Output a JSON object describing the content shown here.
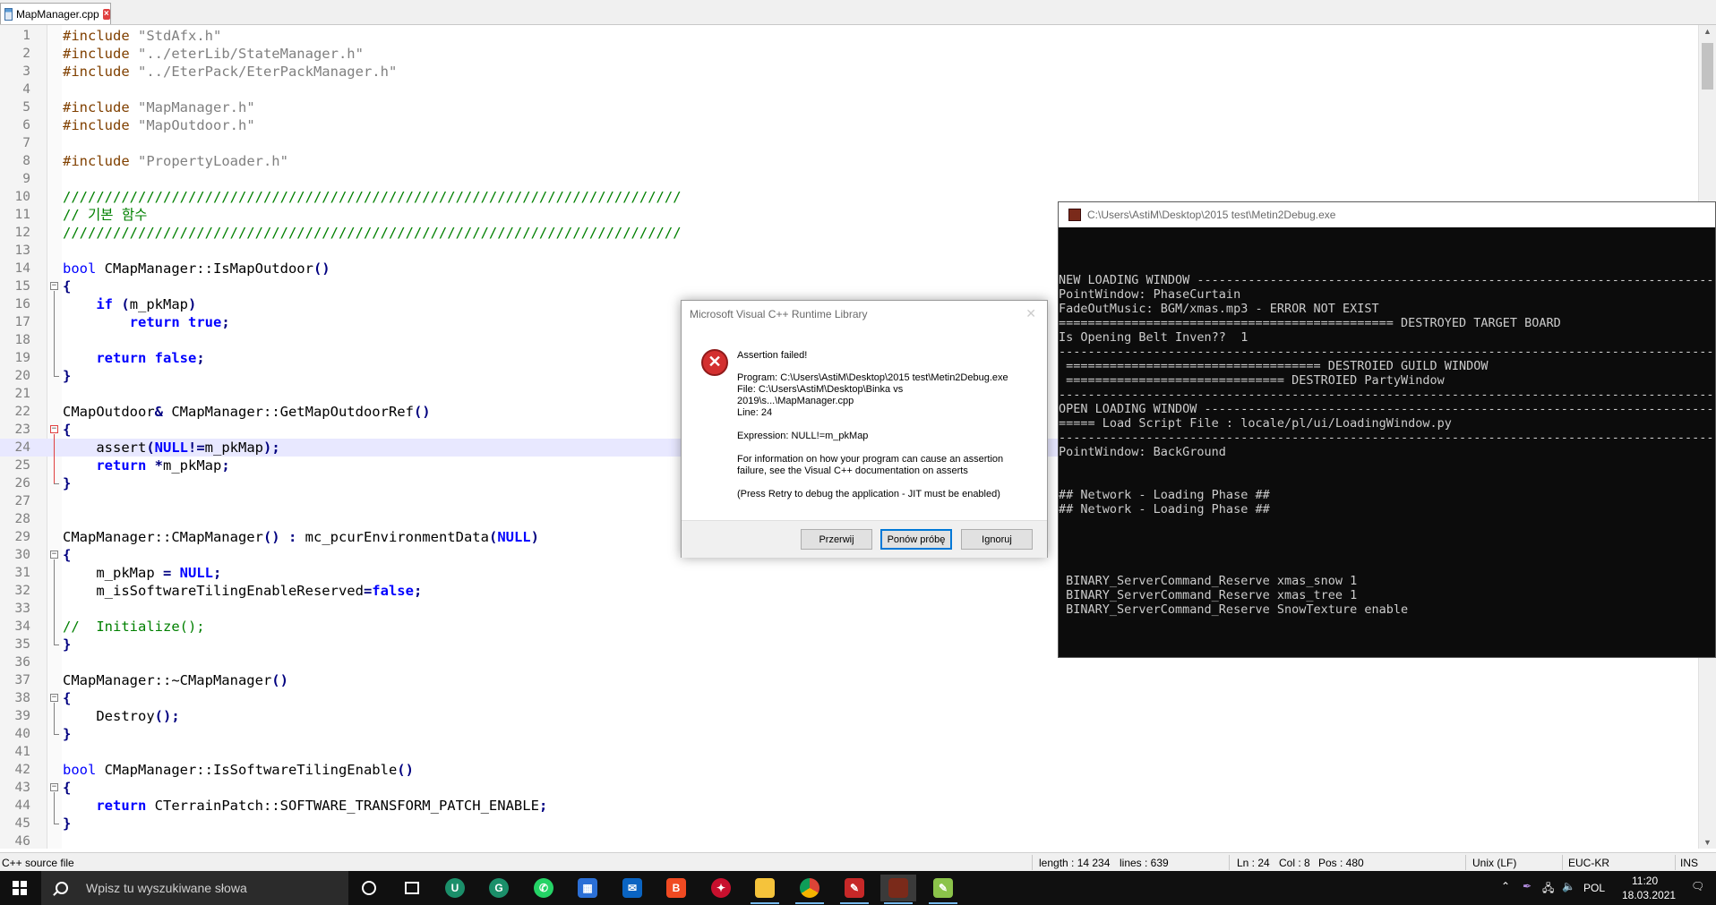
{
  "tab": {
    "filename": "MapManager.cpp"
  },
  "editor": {
    "lines": [
      {
        "n": "1",
        "code": "<span class=\"kw2\" style=\"font-weight:normal;color:#804000\">#include</span> <span class=\"str\">\"StdAfx.h\"</span>"
      },
      {
        "n": "2",
        "code": "<span style=\"color:#804000\">#include</span> <span class=\"str\">\"../eterLib/StateManager.h\"</span>"
      },
      {
        "n": "3",
        "code": "<span style=\"color:#804000\">#include</span> <span class=\"str\">\"../EterPack/EterPackManager.h\"</span>"
      },
      {
        "n": "4",
        "code": ""
      },
      {
        "n": "5",
        "code": "<span style=\"color:#804000\">#include</span> <span class=\"str\">\"MapManager.h\"</span>"
      },
      {
        "n": "6",
        "code": "<span style=\"color:#804000\">#include</span> <span class=\"str\">\"MapOutdoor.h\"</span>"
      },
      {
        "n": "7",
        "code": ""
      },
      {
        "n": "8",
        "code": "<span style=\"color:#804000\">#include</span> <span class=\"str\">\"PropertyLoader.h\"</span>"
      },
      {
        "n": "9",
        "code": ""
      },
      {
        "n": "10",
        "code": "<span class=\"cm\">//////////////////////////////////////////////////////////////////////////</span>"
      },
      {
        "n": "11",
        "code": "<span class=\"cm\">// 기본 함수</span>"
      },
      {
        "n": "12",
        "code": "<span class=\"cm\">//////////////////////////////////////////////////////////////////////////</span>"
      },
      {
        "n": "13",
        "code": ""
      },
      {
        "n": "14",
        "code": "<span class=\"kw\">bool</span> CMapManager::IsMapOutdoor<span class=\"op\">()</span>"
      },
      {
        "n": "15",
        "code": "<span class=\"op\">{</span>"
      },
      {
        "n": "16",
        "code": "    <span class=\"kw\" style=\"font-weight:bold;color:#0000ff\">if</span> <span class=\"op\">(</span>m_pkMap<span class=\"op\">)</span>"
      },
      {
        "n": "17",
        "code": "        <span class=\"kw\" style=\"font-weight:bold\">return</span> <span class=\"kw\" style=\"font-weight:bold\">true</span><span class=\"op\">;</span>"
      },
      {
        "n": "18",
        "code": ""
      },
      {
        "n": "19",
        "code": "    <span class=\"kw\" style=\"font-weight:bold\">return</span> <span class=\"kw\" style=\"font-weight:bold\">false</span><span class=\"op\">;</span>"
      },
      {
        "n": "20",
        "code": "<span class=\"op\">}</span>"
      },
      {
        "n": "21",
        "code": ""
      },
      {
        "n": "22",
        "code": "CMapOutdoor<span class=\"op\">&amp;</span> CMapManager::GetMapOutdoorRef<span class=\"op\">()</span>"
      },
      {
        "n": "23",
        "code": "<span class=\"op\">{</span>"
      },
      {
        "n": "24",
        "code": "    assert<span class=\"op\">(</span><span class=\"kw\" style=\"font-weight:bold\">NULL</span><span class=\"op\">!=</span>m_pkMap<span class=\"op\">);</span>"
      },
      {
        "n": "25",
        "code": "    <span class=\"kw\" style=\"font-weight:bold\">return</span> <span class=\"op\">*</span>m_pkMap<span class=\"op\">;</span>"
      },
      {
        "n": "26",
        "code": "<span class=\"op\">}</span>"
      },
      {
        "n": "27",
        "code": ""
      },
      {
        "n": "28",
        "code": ""
      },
      {
        "n": "29",
        "code": "CMapManager::CMapManager<span class=\"op\">()</span> <span class=\"op\">:</span> mc_pcurEnvironmentData<span class=\"op\">(</span><span class=\"kw\" style=\"font-weight:bold\">NULL</span><span class=\"op\">)</span>"
      },
      {
        "n": "30",
        "code": "<span class=\"op\">{</span>"
      },
      {
        "n": "31",
        "code": "    m_pkMap <span class=\"op\">=</span> <span class=\"kw\" style=\"font-weight:bold\">NULL</span><span class=\"op\">;</span>"
      },
      {
        "n": "32",
        "code": "    m_isSoftwareTilingEnableReserved<span class=\"op\">=</span><span class=\"kw\" style=\"font-weight:bold\">false</span><span class=\"op\">;</span>"
      },
      {
        "n": "33",
        "code": ""
      },
      {
        "n": "34",
        "code": "<span class=\"cm\">//  Initialize();</span>"
      },
      {
        "n": "35",
        "code": "<span class=\"op\">}</span>"
      },
      {
        "n": "36",
        "code": ""
      },
      {
        "n": "37",
        "code": "CMapManager::~CMapManager<span class=\"op\">()</span>"
      },
      {
        "n": "38",
        "code": "<span class=\"op\">{</span>"
      },
      {
        "n": "39",
        "code": "    Destroy<span class=\"op\">();</span>"
      },
      {
        "n": "40",
        "code": "<span class=\"op\">}</span>"
      },
      {
        "n": "41",
        "code": ""
      },
      {
        "n": "42",
        "code": "<span class=\"kw\">bool</span> CMapManager::IsSoftwareTilingEnable<span class=\"op\">()</span>"
      },
      {
        "n": "43",
        "code": "<span class=\"op\">{</span>"
      },
      {
        "n": "44",
        "code": "    <span class=\"kw\" style=\"font-weight:bold\">return</span> CTerrainPatch::SOFTWARE_TRANSFORM_PATCH_ENABLE<span class=\"op\">;</span>"
      },
      {
        "n": "45",
        "code": "<span class=\"op\">}</span>"
      },
      {
        "n": "46",
        "code": ""
      }
    ]
  },
  "status": {
    "filetype": "C++ source file",
    "length": "length : 14 234",
    "lines": "lines : 639",
    "ln": "Ln : 24",
    "col": "Col : 8",
    "pos": "Pos : 480",
    "eol": "Unix (LF)",
    "encoding": "EUC-KR",
    "mode": "INS"
  },
  "console": {
    "title": "C:\\Users\\AstiM\\Desktop\\2015 test\\Metin2Debug.exe",
    "lines": [
      {
        "y": 0,
        "t": ""
      },
      {
        "y": 1,
        "t": ""
      },
      {
        "y": 2,
        "t": ""
      },
      {
        "y": 3,
        "t": "NEW LOADING WINDOW ----------------------------------------------------------------------------------------"
      },
      {
        "y": 4,
        "t": "PointWindow: PhaseCurtain"
      },
      {
        "y": 5,
        "t": "FadeOutMusic: BGM/xmas.mp3 - ERROR NOT EXIST"
      },
      {
        "y": 6,
        "t": "============================================== DESTROYED TARGET BOARD"
      },
      {
        "y": 7,
        "t": "Is Opening Belt Inven??  1"
      },
      {
        "y": 8,
        "t": "------------------------------------------------------------------------------------------------------------------------- DESTROY EXCHANGE"
      },
      {
        "y": 9,
        "t": " =================================== DESTROIED GUILD WINDOW"
      },
      {
        "y": 10,
        "t": " ============================== DESTROIED PartyWindow"
      },
      {
        "y": 11,
        "t": "------------------------------------------------------------------------------------------------------------------------- CLOSE GAME WINDOW"
      },
      {
        "y": 12,
        "t": "OPEN LOADING WINDOW ----------------------------------------------------------------------------------------"
      },
      {
        "y": 13,
        "t": "===== Load Script File : locale/pl/ui/LoadingWindow.py"
      },
      {
        "y": 14,
        "t": "------------------------------------------------------------------------------------------------------------------------- DELETE CURTAIN"
      },
      {
        "y": 15,
        "t": "PointWindow: BackGround"
      },
      {
        "y": 16,
        "t": ""
      },
      {
        "y": 17,
        "t": ""
      },
      {
        "y": 18,
        "t": "## Network - Loading Phase ##"
      },
      {
        "y": 19,
        "t": "## Network - Loading Phase ##"
      },
      {
        "y": 20,
        "t": ""
      },
      {
        "y": 21,
        "t": ""
      },
      {
        "y": 22,
        "t": ""
      },
      {
        "y": 23,
        "t": ""
      },
      {
        "y": 24,
        "t": " BINARY_ServerCommand_Reserve xmas_snow 1"
      },
      {
        "y": 25,
        "t": " BINARY_ServerCommand_Reserve xmas_tree 1"
      },
      {
        "y": 26,
        "t": " BINARY_ServerCommand_Reserve SnowTexture enable"
      }
    ]
  },
  "dialog": {
    "title": "Microsoft Visual C++ Runtime Library",
    "heading": "Assertion failed!",
    "program_file": "Program: C:\\Users\\AstiM\\Desktop\\2015 test\\Metin2Debug.exe\nFile: C:\\Users\\AstiM\\Desktop\\Binka vs\n2019\\s...\\MapManager.cpp\nLine: 24",
    "expression": "Expression: NULL!=m_pkMap",
    "info": "For information on how your program can cause an assertion\nfailure, see the Visual C++ documentation on asserts",
    "retry_hint": "(Press Retry to debug the application - JIT must be enabled)",
    "buttons": {
      "abort": "Przerwij",
      "retry": "Ponów próbę",
      "ignore": "Ignoruj"
    }
  },
  "taskbar": {
    "search_placeholder": "Wpisz tu wyszukiwane słowa",
    "language": "POL",
    "time": "11:20",
    "date": "18.03.2021"
  },
  "colors": {
    "accent": "#0078d7",
    "error": "#d32f2f",
    "comment": "#008000",
    "keyword": "#0000ff"
  }
}
